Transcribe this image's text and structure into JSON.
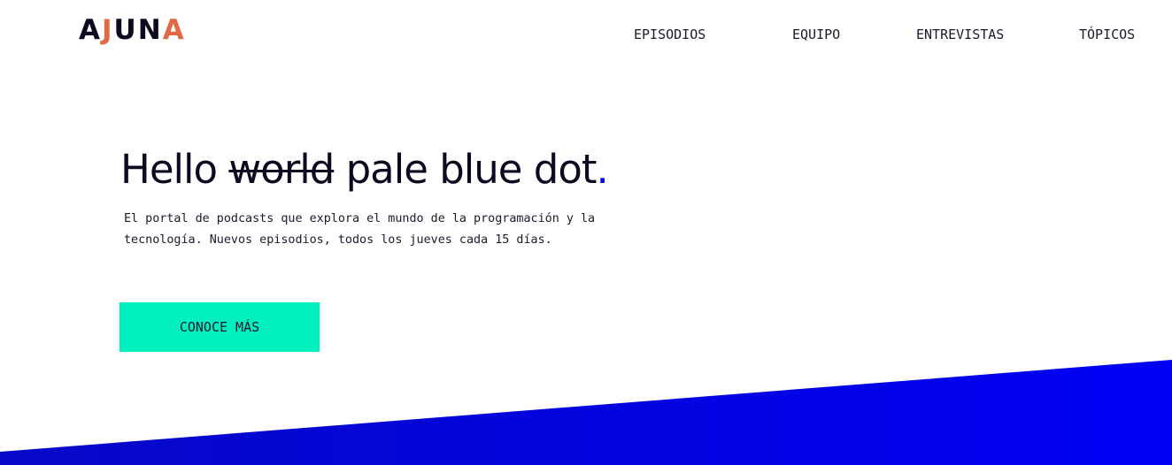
{
  "logo": {
    "letters": [
      "A",
      "J",
      "U",
      "N",
      "A"
    ],
    "text": "AJUNA"
  },
  "nav": {
    "items": [
      {
        "label": "EPISODIOS"
      },
      {
        "label": "EQUIPO"
      },
      {
        "label": "ENTREVISTAS"
      },
      {
        "label": "TÓPICOS"
      }
    ]
  },
  "hero": {
    "title_prefix": "Hello ",
    "title_struck": "world",
    "title_suffix": " pale blue dot",
    "title_dot": ".",
    "description": "El portal de podcasts que explora el mundo de la programación y la tecnología. Nuevos episodios, todos los jueves cada 15 días.",
    "cta_label": "CONOCE MÁS"
  },
  "colors": {
    "accent_blue": "#0000ee",
    "cta_mint": "#00f0c0",
    "logo_orange": "#e06a44",
    "text_dark": "#0c0a20"
  }
}
